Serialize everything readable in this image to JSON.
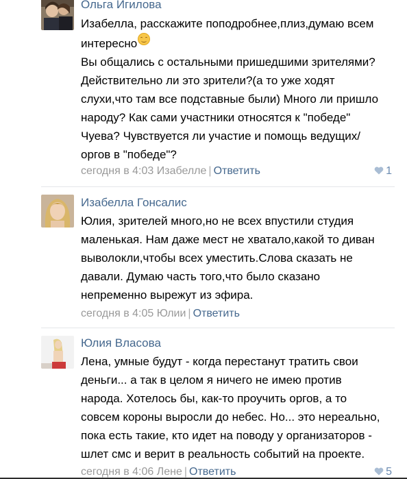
{
  "comments": [
    {
      "author": "Ольга Игилова",
      "lines": [
        "Изабелла, расскажите поподробнее,плиз,думаю всем",
        "интересно",
        "Вы общались с остальными пришедшими зрителями?",
        "Действительно ли это зрители?(а то уже ходят",
        "слухи,что там все подставные были) Много ли пришло",
        "народу? Как сами участники относятся к \"победе\"",
        "Чуева? Чувствуется ли участие и помощь ведущих/",
        "оргов в \"победе\"?"
      ],
      "emoji": "smile-emoji",
      "time": "сегодня в 4:03 Изабелле",
      "reply": "Ответить",
      "likes": "1"
    },
    {
      "author": "Изабелла Гонсалис",
      "lines": [
        "Юлия, зрителей много,но не всех впустили студия",
        "маленькая. Нам даже мест не хватало,какой то диван",
        "выволокли,чтобы всех уместить.Слова сказать не",
        "давали. Думаю часть того,что было сказано",
        "непременно вырежут из эфира."
      ],
      "time": "сегодня в 4:05 Юлии",
      "reply": "Ответить"
    },
    {
      "author": "Юлия Власова",
      "lines": [
        "Лена, умные будут - когда перестанут тратить свои",
        "деньги... а так в целом я ничего не имею против",
        "народа. Хотелось бы, как-то проучить оргов, а то",
        "совсем короны выросли до небес. Но... это нереально,",
        "пока есть такие, кто идет на поводу у организаторов -",
        "шлет смс и верит в реальность событий на проекте."
      ],
      "time": "сегодня в 4:06 Лене",
      "reply": "Ответить",
      "likes": "5"
    }
  ],
  "colors": {
    "link": "#45688e",
    "meta": "#999999",
    "like": "#6a8ab0"
  }
}
